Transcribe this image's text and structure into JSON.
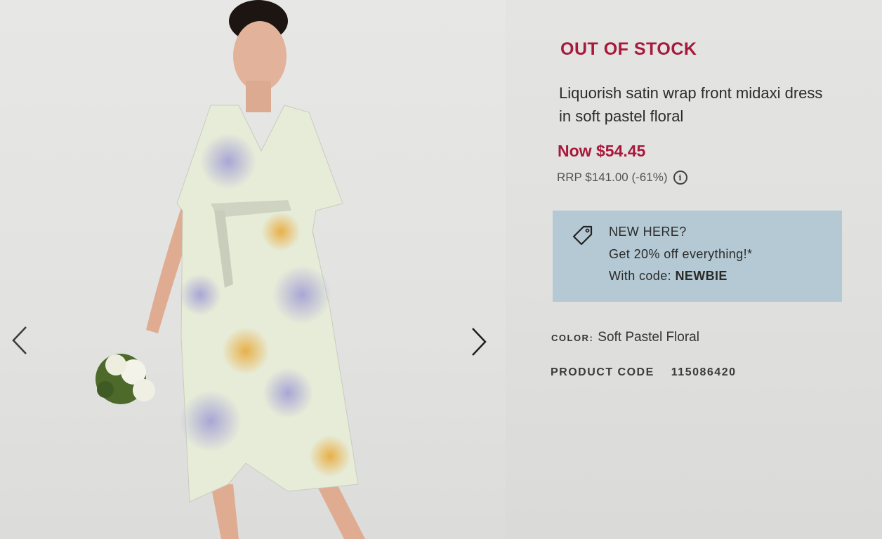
{
  "product": {
    "stock_status": "OUT OF STOCK",
    "title": "Liquorish satin wrap front midaxi dress in soft pastel floral",
    "price_now": "Now $54.45",
    "rrp": "RRP $141.00 (-61%)",
    "info_icon": "info-icon"
  },
  "promo": {
    "icon": "tag-icon",
    "heading": "NEW HERE?",
    "offer": "Get 20% off everything!*",
    "code_prefix": "With code: ",
    "code": "NEWBIE"
  },
  "attributes": {
    "color_label": "COLOR:",
    "color_value": "Soft Pastel Floral",
    "code_label": "PRODUCT CODE",
    "code_value": "115086420"
  },
  "gallery": {
    "prev_icon": "chevron-left-icon",
    "next_icon": "chevron-right-icon"
  },
  "colors": {
    "accent": "#a8183a",
    "promo_bg": "#b4c9d3",
    "text": "#2b2b2b"
  }
}
